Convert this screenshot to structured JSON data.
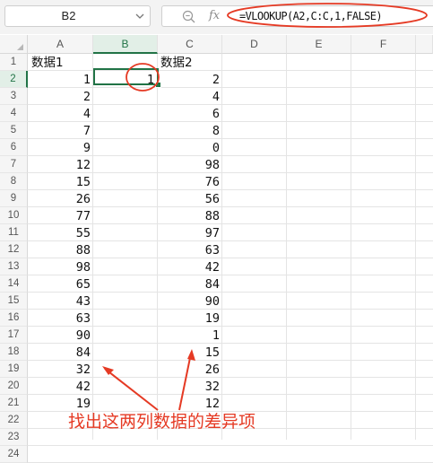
{
  "name_box": {
    "value": "B2"
  },
  "formula_bar": {
    "fx_label": "fx",
    "formula": "=VLOOKUP(A2,C:C,1,FALSE)"
  },
  "columns": [
    "A",
    "B",
    "C",
    "D",
    "E",
    "F"
  ],
  "selected_column": "B",
  "selected_row": 2,
  "rows": [
    "1",
    "2",
    "3",
    "4",
    "5",
    "6",
    "7",
    "8",
    "9",
    "10",
    "11",
    "12",
    "13",
    "14",
    "15",
    "16",
    "17",
    "18",
    "19",
    "20",
    "21",
    "22",
    "23",
    "24"
  ],
  "headers": {
    "A1": "数据1",
    "C1": "数据2"
  },
  "col_a": [
    "1",
    "2",
    "4",
    "7",
    "9",
    "12",
    "15",
    "26",
    "77",
    "55",
    "88",
    "98",
    "65",
    "43",
    "63",
    "90",
    "84",
    "32",
    "42",
    "19"
  ],
  "col_b": [
    "1"
  ],
  "col_c": [
    "2",
    "4",
    "6",
    "8",
    "0",
    "98",
    "76",
    "56",
    "88",
    "97",
    "63",
    "42",
    "84",
    "90",
    "19",
    "1",
    "15",
    "26",
    "32",
    "12"
  ],
  "annotation": {
    "text": "找出这两列数据的差异项",
    "color": "#e53a24"
  },
  "colors": {
    "accent": "#217346",
    "annotation_red": "#e53a24"
  }
}
